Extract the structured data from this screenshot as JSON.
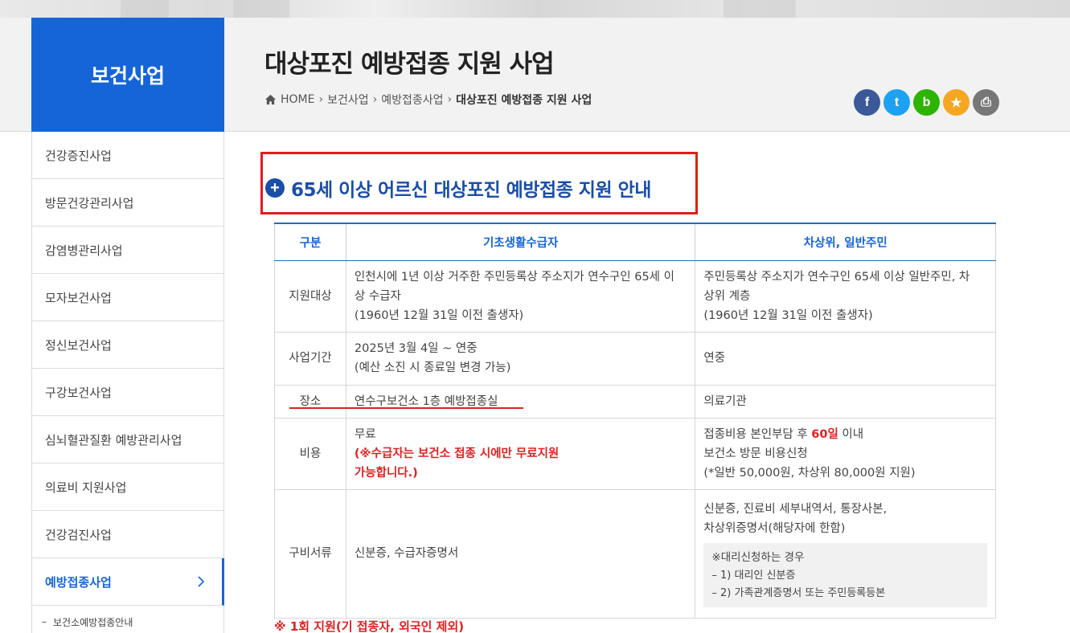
{
  "header": {
    "section_title": "보건사업",
    "page_title": "대상포진 예방접종 지원 사업",
    "breadcrumb": {
      "home": "HOME",
      "level1": "보건사업",
      "level2": "예방접종사업",
      "current": "대상포진 예방접종 지원 사업"
    },
    "share": [
      {
        "name": "facebook",
        "glyph": "f",
        "color": "#3b5998"
      },
      {
        "name": "twitter",
        "glyph": "t",
        "color": "#1da1f2"
      },
      {
        "name": "band",
        "glyph": "b",
        "color": "#2db400"
      },
      {
        "name": "bookmark",
        "glyph": "★",
        "color": "#f5a623"
      },
      {
        "name": "print",
        "glyph": "⎙",
        "color": "#777777"
      }
    ]
  },
  "sidebar": {
    "items": [
      {
        "label": "건강증진사업"
      },
      {
        "label": "방문건강관리사업"
      },
      {
        "label": "감염병관리사업"
      },
      {
        "label": "모자보건사업"
      },
      {
        "label": "정신보건사업"
      },
      {
        "label": "구강보건사업"
      },
      {
        "label": "심뇌혈관질환 예방관리사업"
      },
      {
        "label": "의료비 지원사업"
      },
      {
        "label": "건강검진사업"
      },
      {
        "label": "예방접종사업"
      }
    ],
    "sub_item": "보건소예방접종안내"
  },
  "main": {
    "section_heading": "65세 이상 어르신 대상포진 예방접종 지원 안내",
    "table": {
      "headers": [
        "구분",
        "기초생활수급자",
        "차상위, 일반주민"
      ],
      "rows": {
        "target": {
          "label": "지원대상",
          "col1_l1": "인천시에 1년 이상 거주한 주민등록상 주소지가 연수구인 65세 이",
          "col1_l2": "상 수급자",
          "col1_l3": "(1960년 12월 31일 이전 출생자)",
          "col2_l1": "주민등록상 주소지가 연수구인 65세 이상 일반주민, 차",
          "col2_l2": "상위 계층",
          "col2_l3": "(1960년 12월 31일 이전 출생자)"
        },
        "period": {
          "label": "사업기간",
          "col1_l1": "2025년 3월 4일 ~ 연중",
          "col1_l2": "(예산 소진 시 종료일 변경 가능)",
          "col2": "연중"
        },
        "place": {
          "label": "장소",
          "col1": "연수구보건소 1층 예방접종실",
          "col2": "의료기관"
        },
        "cost": {
          "label": "비용",
          "col1_l1": "무료",
          "col1_red_l1": "(※수급자는 보건소 접종 시에만 무료지원",
          "col1_red_l2": "가능합니다.)",
          "col2_l1_pre": "접종비용 본인부담 후 ",
          "col2_l1_red": "60일",
          "col2_l1_post": " 이내",
          "col2_l2": "보건소 방문 비용신청",
          "col2_l3": "(*일반 50,000원, 차상위 80,000원 지원)"
        },
        "docs": {
          "label": "구비서류",
          "col1": "신분증, 수급자증명서",
          "col2_l1": "신분증, 진료비 세부내역서, 통장사본,",
          "col2_l2": "차상위증명서(해당자에 한함)",
          "box_title": "※대리신청하는 경우",
          "box_l1": "– 1) 대리인 신분증",
          "box_l2": "– 2) 가족관계증명서 또는 주민등록등본"
        }
      }
    },
    "footnote": "※ 1회 지원(기 접종자, 외국인 제외)"
  },
  "colors": {
    "brand_blue": "#1565d8",
    "heading_blue": "#1a4ea8",
    "highlight_red": "#e11d1d"
  }
}
